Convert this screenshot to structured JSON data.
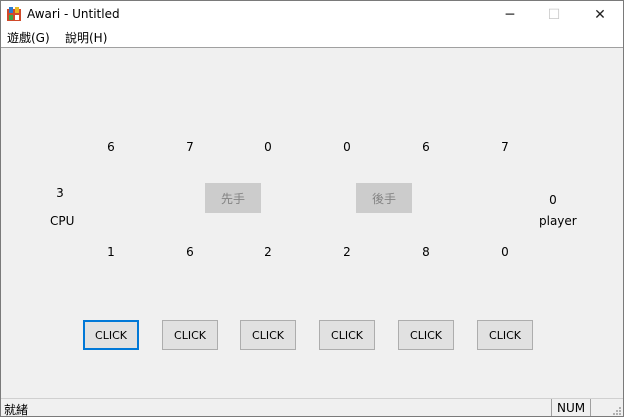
{
  "window": {
    "title": "Awari - Untitled",
    "controls": {
      "minimize": "─",
      "maximize": "☐",
      "close": "✕"
    }
  },
  "menu": [
    {
      "label": "遊戲(G)"
    },
    {
      "label": "說明(H)"
    }
  ],
  "board": {
    "cpu_pits": [
      "6",
      "7",
      "0",
      "0",
      "6",
      "7"
    ],
    "player_pits": [
      "1",
      "6",
      "2",
      "2",
      "8",
      "0"
    ],
    "cpu_store": "3",
    "cpu_label": "CPU",
    "player_store": "0",
    "player_label": "player"
  },
  "buttons": {
    "first_move": "先手",
    "second_move": "後手",
    "click": [
      "CLICK",
      "CLICK",
      "CLICK",
      "CLICK",
      "CLICK",
      "CLICK"
    ]
  },
  "status": {
    "text": "就緒",
    "num": "NUM"
  }
}
